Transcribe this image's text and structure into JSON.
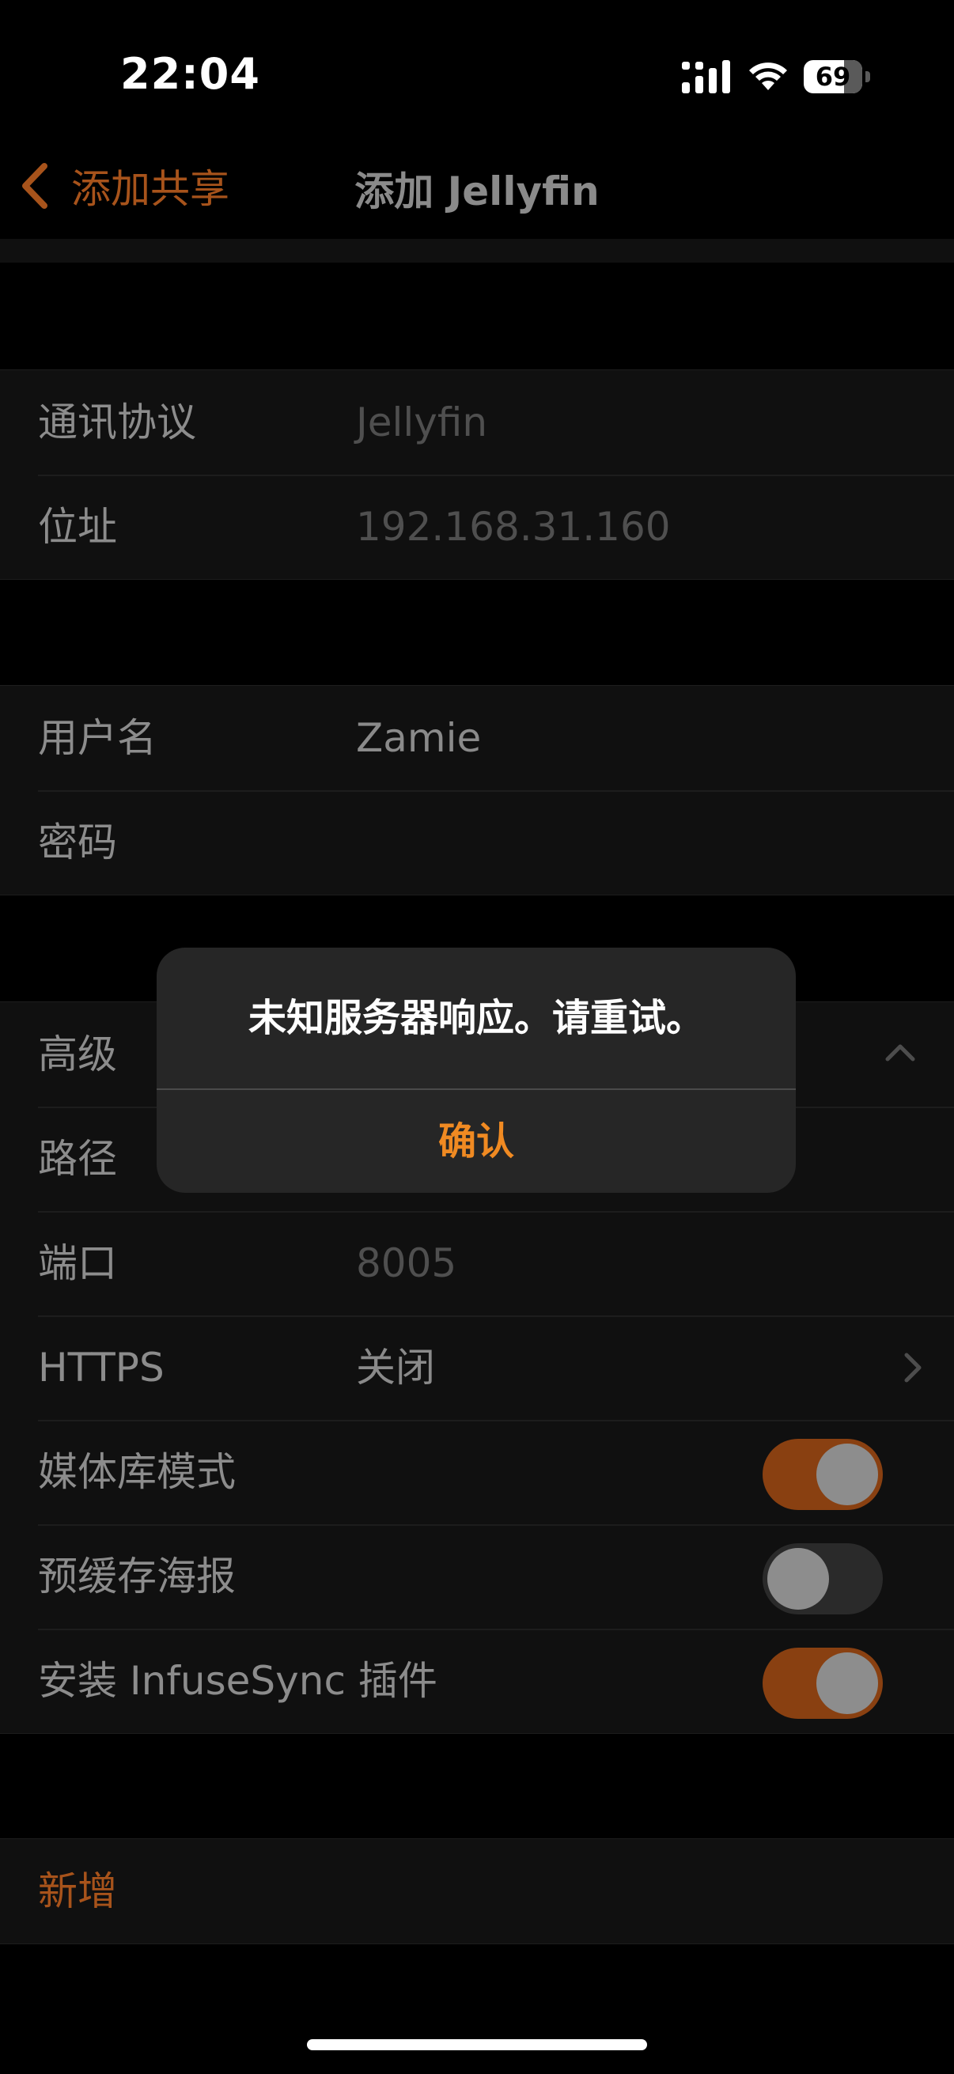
{
  "status_bar": {
    "time": "22:04",
    "battery": "69",
    "battery_level_percent": 69
  },
  "nav": {
    "back_label": "添加共享",
    "title": "添加 Jellyfin"
  },
  "connection": {
    "protocol_label": "通讯协议",
    "protocol_value": "Jellyfin",
    "address_label": "位址",
    "address_value": "192.168.31.160"
  },
  "credentials": {
    "username_label": "用户名",
    "username_value": "Zamie",
    "password_label": "密码",
    "password_value": ""
  },
  "advanced": {
    "label": "高级",
    "path_label": "路径",
    "port_label": "端口",
    "port_value": "8005",
    "https_label": "HTTPS",
    "https_value": "关闭",
    "library_mode_label": "媒体库模式",
    "library_mode_on": true,
    "precache_posters_label": "预缓存海报",
    "precache_posters_on": false,
    "infusesync_label": "安装 InfuseSync 插件",
    "infusesync_on": true
  },
  "add": {
    "label": "新增"
  },
  "alert": {
    "message": "未知服务器响应。请重试。",
    "confirm_label": "确认"
  },
  "colors": {
    "accent": "#F08A22",
    "dim_accent": "#A7531B",
    "toggle_on": "#894011"
  }
}
